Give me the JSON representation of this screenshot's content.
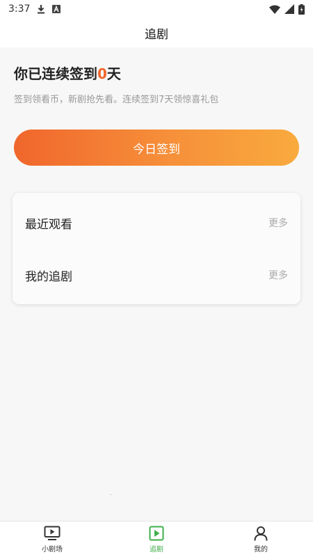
{
  "status_bar": {
    "time": "3:37",
    "icons": [
      "download-icon",
      "a-badge-icon",
      "wifi-icon",
      "signal-icon",
      "battery-icon"
    ]
  },
  "header": {
    "title": "追剧"
  },
  "checkin": {
    "heading_prefix": "你已连续签到",
    "days": "0",
    "heading_suffix": "天",
    "subtitle": "签到领看币，新剧抢先看。连续签到7天领惊喜礼包",
    "button_label": "今日签到",
    "gradient_start": "#f0662c",
    "gradient_end": "#f9aa3e"
  },
  "card": {
    "rows": [
      {
        "label": "最近观看",
        "more": "更多"
      },
      {
        "label": "我的追剧",
        "more": "更多"
      }
    ]
  },
  "tab_bar": {
    "active_color": "#3fae49",
    "tabs": [
      {
        "label": "小剧场",
        "icon": "tv-icon",
        "active": false
      },
      {
        "label": "追剧",
        "icon": "play-icon",
        "active": true
      },
      {
        "label": "我的",
        "icon": "user-icon",
        "active": false
      }
    ]
  }
}
